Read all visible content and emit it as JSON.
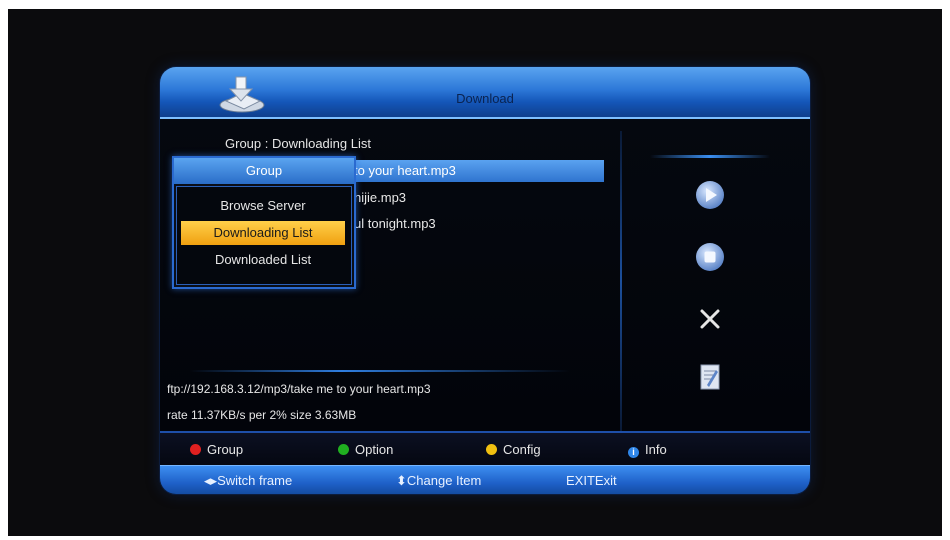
{
  "header": {
    "title": "Download"
  },
  "group_heading": "Group : Downloading List",
  "files": [
    {
      "name": "to your heart.mp3",
      "selected": true
    },
    {
      "name": "hijie.mp3",
      "selected": false
    },
    {
      "name": "ul tonight.mp3",
      "selected": false
    }
  ],
  "popup": {
    "title": "Group",
    "items": [
      {
        "label": "Browse Server"
      },
      {
        "label": "Downloading List"
      },
      {
        "label": "Downloaded List"
      }
    ],
    "selected_index": 1
  },
  "status": {
    "url": "ftp://192.168.3.12/mp3/take me to your heart.mp3",
    "rate": "rate 11.37KB/s  per 2%  size 3.63MB"
  },
  "side_icons": [
    "play-icon",
    "stop-icon",
    "close-icon",
    "edit-icon"
  ],
  "help_bar": [
    {
      "color": "#e02020",
      "label": "Group"
    },
    {
      "color": "#20b020",
      "label": "Option"
    },
    {
      "color": "#f0c010",
      "label": "Config"
    },
    {
      "icon": "info-icon",
      "label": "Info"
    }
  ],
  "nav_bar": {
    "switch_frame": "Switch frame",
    "change_item": "Change Item",
    "exit_key": "EXIT",
    "exit_label": "Exit"
  },
  "colors": {
    "accent_blue": "#2d78d8",
    "highlight_yellow": "#f0a010"
  }
}
